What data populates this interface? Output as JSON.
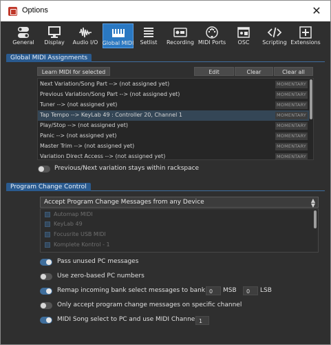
{
  "window": {
    "title": "Options",
    "close_glyph": "✕"
  },
  "toolbar": {
    "items": [
      {
        "label": "General",
        "icon": "toggles-icon"
      },
      {
        "label": "Display",
        "icon": "monitor-icon"
      },
      {
        "label": "Audio I/O",
        "icon": "waveform-icon"
      },
      {
        "label": "Global MIDI",
        "icon": "keyboard-icon",
        "active": true
      },
      {
        "label": "Setlist",
        "icon": "list-icon"
      },
      {
        "label": "Recording",
        "icon": "record-icon"
      },
      {
        "label": "MIDI Ports",
        "icon": "midi-port-icon"
      },
      {
        "label": "OSC",
        "icon": "osc-icon"
      },
      {
        "label": "Scripting",
        "icon": "code-icon"
      },
      {
        "label": "Extensions",
        "icon": "plus-box-icon"
      }
    ]
  },
  "global_midi": {
    "header": "Global MIDI Assignments",
    "learn_button": "Learn MIDI for selected item",
    "edit_button": "Edit",
    "clear_selected_button": "Clear selected",
    "clear_all_button": "Clear all",
    "momentary_label": "MOMENTARY",
    "assignments": [
      {
        "text": "Next Variation/Song Part --> (not assigned yet)"
      },
      {
        "text": "Previous Variation/Song Part --> (not assigned yet)"
      },
      {
        "text": "Tuner --> (not assigned yet)"
      },
      {
        "text": "Tap Tempo --> KeyLab 49 : Controller 20, Channel 1",
        "selected": true
      },
      {
        "text": "Play/Stop --> (not assigned yet)"
      },
      {
        "text": "Panic --> (not assigned yet)"
      },
      {
        "text": "Master Trim --> (not assigned yet)"
      },
      {
        "text": "Variation Direct Access --> (not assigned yet)"
      }
    ],
    "stay_within_rackspace_label": "Previous/Next variation stays within rackspace",
    "stay_within_rackspace": false
  },
  "program_change": {
    "header": "Program Change Control",
    "source_dropdown": "Accept Program Change Messages from any Device",
    "devices": [
      "Automap MIDI",
      "KeyLab 49",
      "Focusrite USB MIDI",
      "Komplete Kontrol - 1"
    ],
    "options": {
      "pass_unused": {
        "label": "Pass unused PC messages",
        "on": true
      },
      "zero_based": {
        "label": "Use zero-based PC numbers",
        "on": false
      },
      "remap_bank": {
        "label": "Remap incoming bank select messages  to bank",
        "on": true,
        "msb_value": "0",
        "msb_label": "MSB",
        "lsb_value": "0",
        "lsb_label": "LSB"
      },
      "specific_channel": {
        "label": "Only accept program change messages on specific channel",
        "on": false
      },
      "song_select": {
        "label": "MIDI Song select to PC  and use MIDI Channel",
        "on": true,
        "channel_value": "1"
      }
    }
  },
  "colors": {
    "accent": "#2a78c2",
    "panel": "#2f2f2f",
    "section_tab": "#2a5a8e"
  }
}
